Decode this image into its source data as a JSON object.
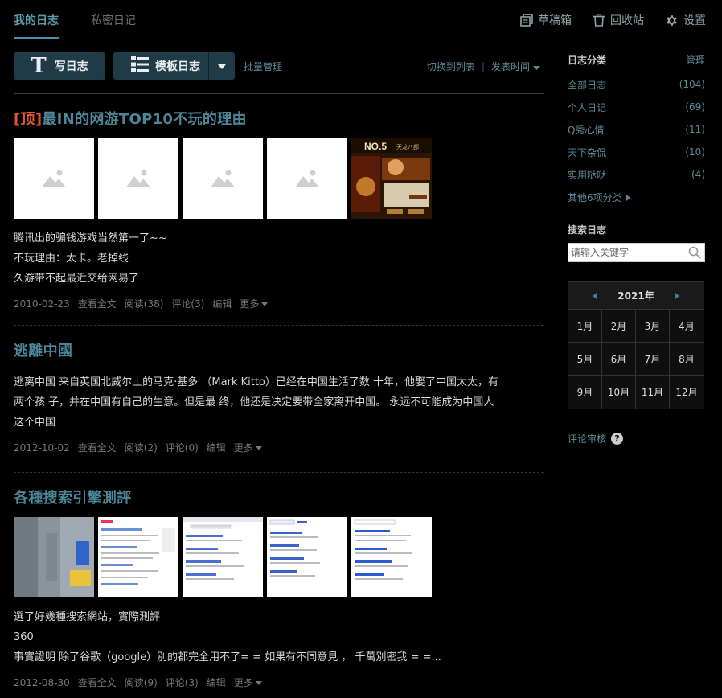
{
  "tabs": {
    "mine": "我的日志",
    "private": "私密日记"
  },
  "top_actions": {
    "drafts": "草稿箱",
    "recycle": "回收站",
    "settings": "设置"
  },
  "toolbar": {
    "write": "写日志",
    "template": "模板日志",
    "batch": "批量管理",
    "switch_list": "切换到列表",
    "sort": "发表时间"
  },
  "posts": [
    {
      "pin": "[顶]",
      "title": "最IN的网游TOP10不玩的理由",
      "lines": [
        "腾讯出的骗钱游戏当然第一了~~",
        "不玩理由：太卡。老掉线",
        "久游带不起最近交给网易了"
      ],
      "date": "2010-02-23",
      "view_full": "查看全文",
      "reads": "阅读(38)",
      "comments": "评论(3)",
      "edit": "编辑",
      "more": "更多",
      "ad_text": {
        "badge": "NO.5",
        "game": "天龙八部"
      }
    },
    {
      "title": "逃離中國",
      "lines": [
        "逃离中国 来自英国北威尔士的马克·基多 （Mark Kitto）已经在中国生活了数 十年，他娶了中国太太，有",
        "两个孩 子，并在中国有自己的生意。但是最 终，他还是决定要带全家离开中国。 永远不可能成为中国人",
        "这个中国"
      ],
      "date": "2012-10-02",
      "view_full": "查看全文",
      "reads": "阅读(2)",
      "comments": "评论(0)",
      "edit": "编辑",
      "more": "更多"
    },
    {
      "title": "各種搜索引擎測評",
      "lines": [
        "選了好幾種搜索網站，實際測評",
        "360",
        "事實證明 除了谷歌（google）別的都完全用不了= = 如果有不同意見 ， 千萬別密我 = =..."
      ],
      "date": "2012-08-30",
      "view_full": "查看全文",
      "reads": "阅读(9)",
      "comments": "评论(3)",
      "edit": "编辑",
      "more": "更多"
    }
  ],
  "sidebar": {
    "categories_title": "日志分类",
    "manage": "管理",
    "categories": [
      {
        "name": "全部日志",
        "count": "(104)"
      },
      {
        "name": "个人日记",
        "count": "(69)"
      },
      {
        "name": "Q秀心情",
        "count": "(11)"
      },
      {
        "name": "天下杂侃",
        "count": "(10)"
      },
      {
        "name": "实用哒哒",
        "count": "(4)"
      }
    ],
    "more_categories": "其他6项分类",
    "search_title": "搜索日志",
    "search_placeholder": "请输入关键字",
    "year": "2021年",
    "months": [
      "1月",
      "2月",
      "3月",
      "4月",
      "5月",
      "6月",
      "7月",
      "8月",
      "9月",
      "10月",
      "11月",
      "12月"
    ],
    "comment_review": "评论审核",
    "help_mark": "?"
  },
  "colors": {
    "accent": "#4e8699",
    "pin": "#e4572e",
    "button": "#1f3b47",
    "background": "#000000"
  }
}
